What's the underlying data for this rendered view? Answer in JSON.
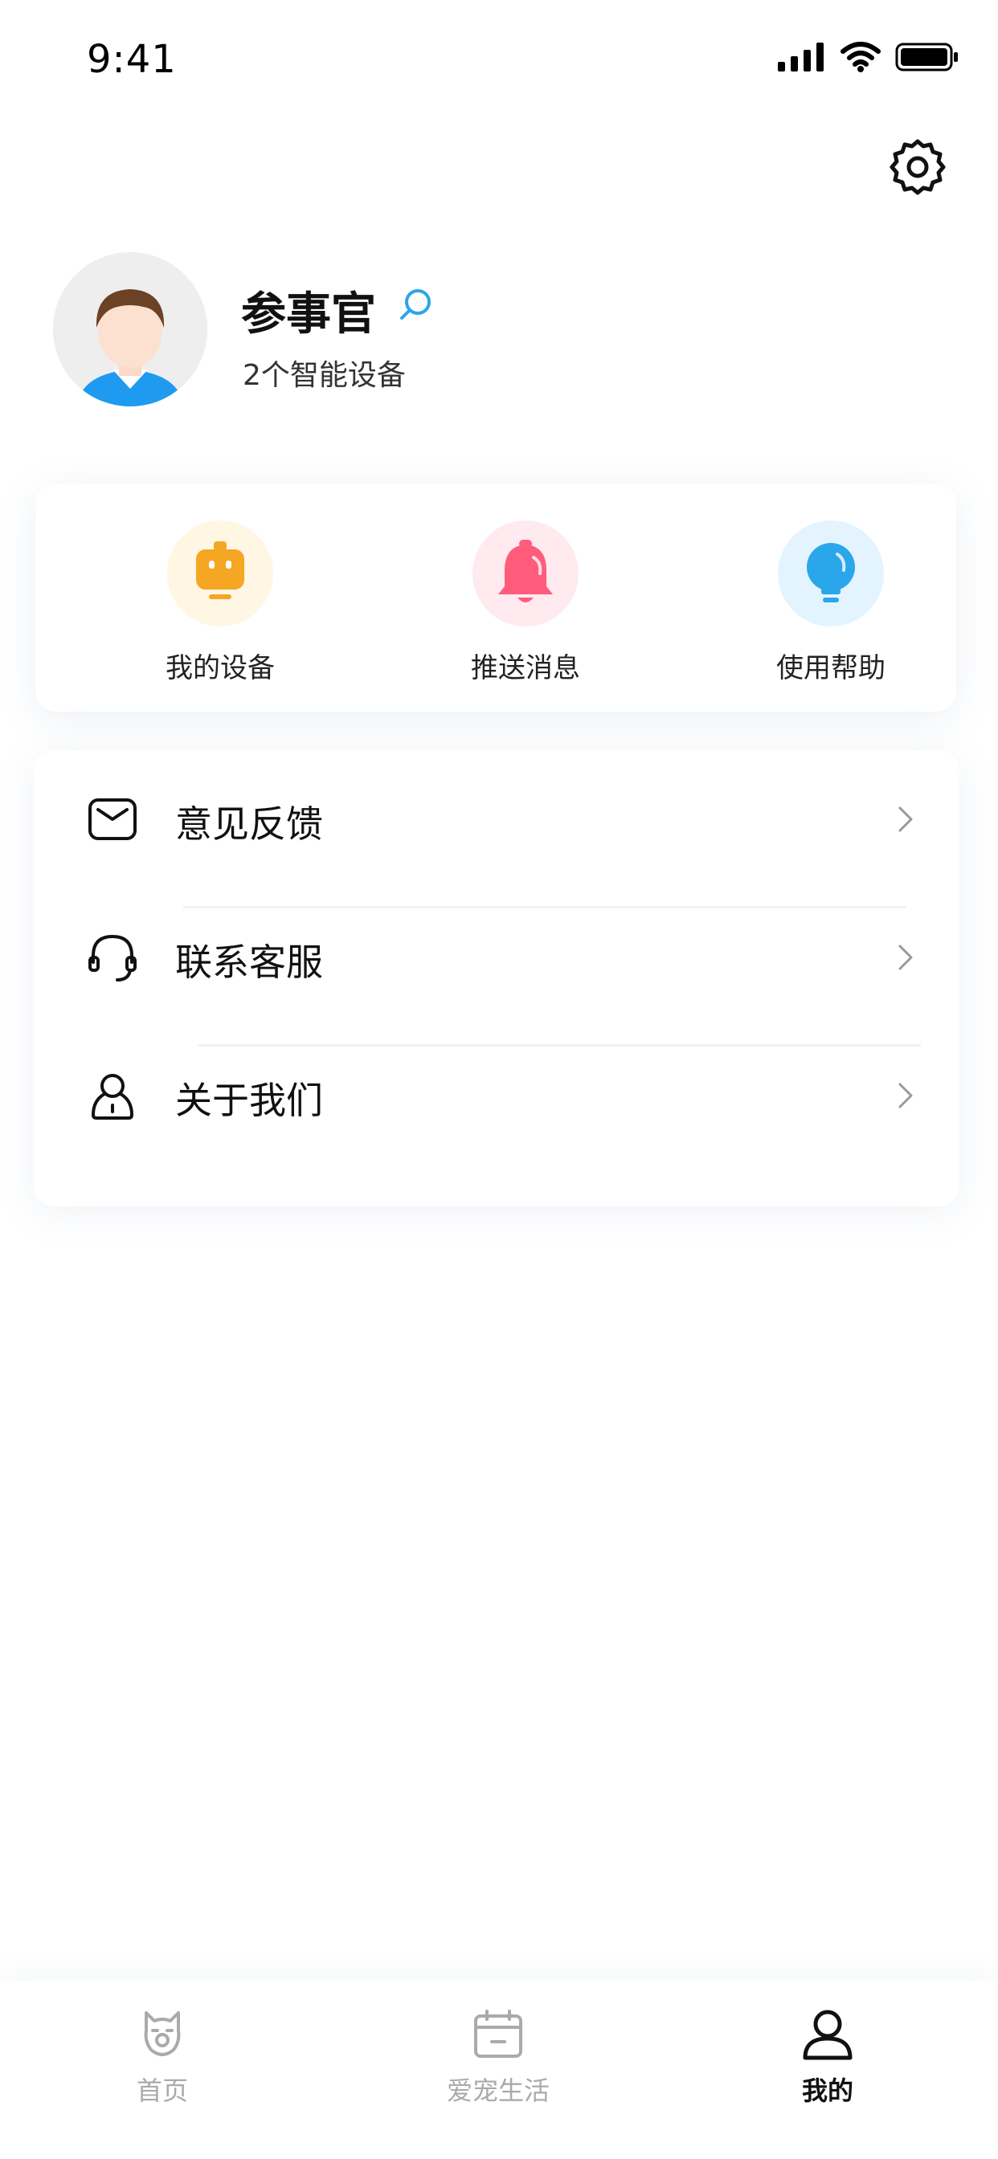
{
  "status_bar": {
    "time": "9:41"
  },
  "profile": {
    "name": "参事官",
    "device_count": "2个智能设备"
  },
  "quick_actions": [
    {
      "label": "我的设备",
      "icon": "robot-device-icon",
      "color": "#F5A623",
      "bg": "#FFF6E3"
    },
    {
      "label": "推送消息",
      "icon": "bell-icon",
      "color": "#FF5C7C",
      "bg": "#FFEAF0"
    },
    {
      "label": "使用帮助",
      "icon": "lightbulb-icon",
      "color": "#2AA6EA",
      "bg": "#E3F4FF"
    }
  ],
  "menu": [
    {
      "label": "意见反馈",
      "icon": "feedback-mail-icon"
    },
    {
      "label": "联系客服",
      "icon": "headset-icon"
    },
    {
      "label": "关于我们",
      "icon": "about-user-icon"
    }
  ],
  "tabs": [
    {
      "label": "首页",
      "icon": "pet-home-icon",
      "active": false
    },
    {
      "label": "爱宠生活",
      "icon": "calendar-icon",
      "active": false
    },
    {
      "label": "我的",
      "icon": "profile-icon",
      "active": true
    }
  ],
  "colors": {
    "accent_blue": "#2AA6EA",
    "inactive": "#AAAAAA",
    "active": "#111111"
  }
}
